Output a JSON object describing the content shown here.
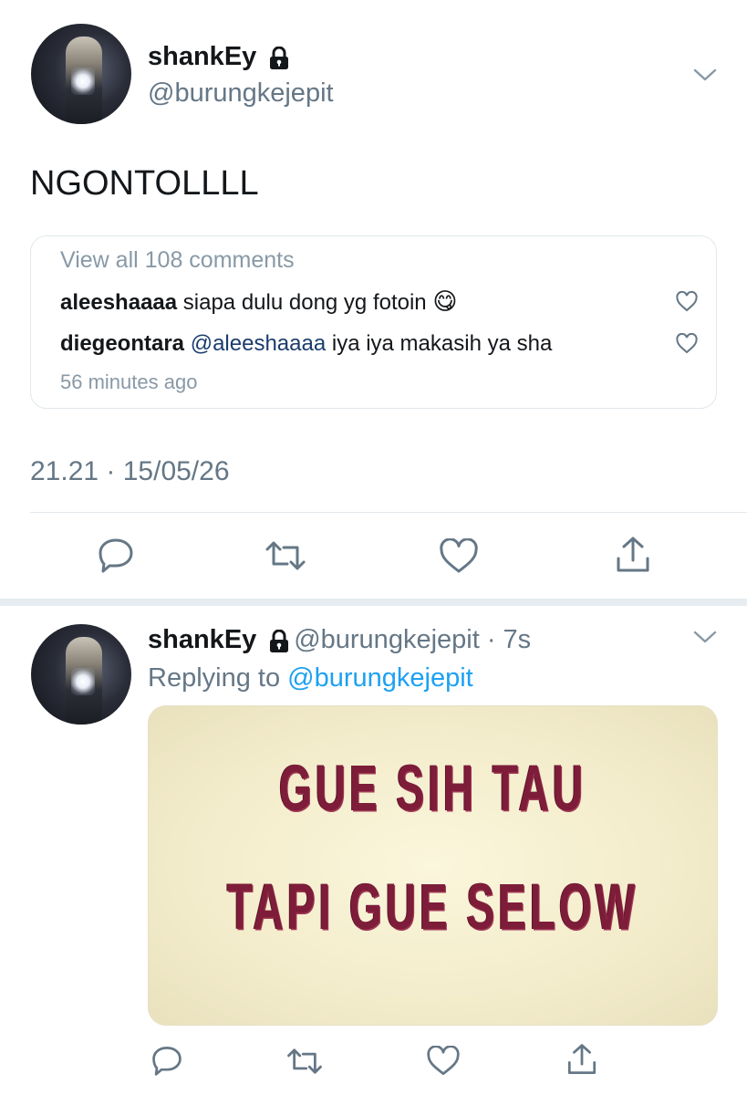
{
  "tweet": {
    "display_name": "shankEy",
    "handle": "@burungkejepit",
    "text": "NGONTOLLLL",
    "comments_card": {
      "view_all": "View all 108 comments",
      "comments": [
        {
          "user": "aleeshaaaa",
          "text": "siapa dulu dong yg fotoin",
          "emoji": "😋"
        },
        {
          "user": "diegeontara",
          "mention": "@aleeshaaaa",
          "text": "iya iya makasih ya sha"
        }
      ],
      "time_ago": "56 minutes ago"
    },
    "timestamp": "21.21 · 15/05/26"
  },
  "reply": {
    "display_name": "shankEy",
    "handle_time": "@burungkejepit · 7s",
    "replying_prefix": "Replying to",
    "replying_handle": "@burungkejepit",
    "meme_lines": [
      "GUE SIH TAU",
      "TAPI GUE SELOW"
    ]
  },
  "colors": {
    "link": "#1da1f2",
    "muted": "#657786",
    "meme_text": "#7d1d3a"
  },
  "icons": [
    "lock-icon",
    "chevron-down-icon",
    "reply-icon",
    "retweet-icon",
    "like-icon",
    "share-icon",
    "heart-outline-icon",
    "emoji-icon"
  ]
}
